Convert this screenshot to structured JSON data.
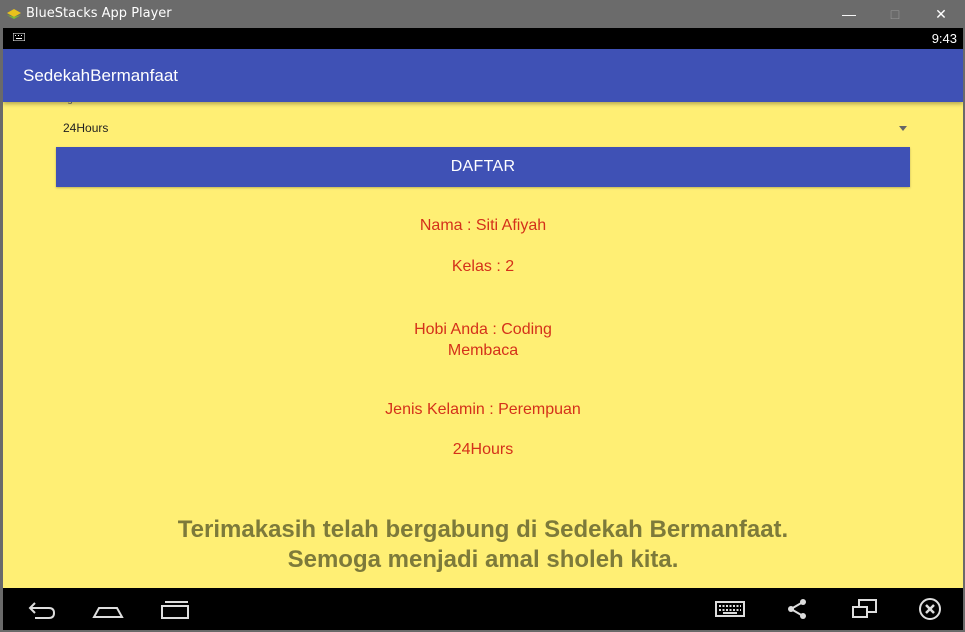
{
  "window": {
    "title": "BlueStacks App Player",
    "minimize": "—",
    "maximize": "□",
    "close": "✕"
  },
  "statusbar": {
    "time": "9:43"
  },
  "appbar": {
    "title": "SedekahBermanfaat"
  },
  "form": {
    "spinner_label": "Angkatan",
    "spinner_value": "24Hours",
    "button_label": "DAFTAR"
  },
  "result": {
    "nama": "Nama : Siti Afiyah",
    "kelas": "Kelas : 2",
    "hobi_line1": "Hobi Anda : Coding",
    "hobi_line2": "Membaca",
    "jenis_kelamin": "Jenis Kelamin : Perempuan",
    "angkatan": "24Hours"
  },
  "thanks": {
    "line1": "Terimakasih telah bergabung di Sedekah Bermanfaat.",
    "line2": "Semoga menjadi amal sholeh kita."
  },
  "nav": {
    "icons": [
      "back-icon",
      "home-icon",
      "recent-apps-icon",
      "keyboard-icon",
      "share-icon",
      "window-icon",
      "close-circle-icon"
    ]
  },
  "colors": {
    "primary": "#3f51b5",
    "background": "#ffef74",
    "result_text": "#d4311a",
    "thanks_text": "#7d7a3a"
  }
}
